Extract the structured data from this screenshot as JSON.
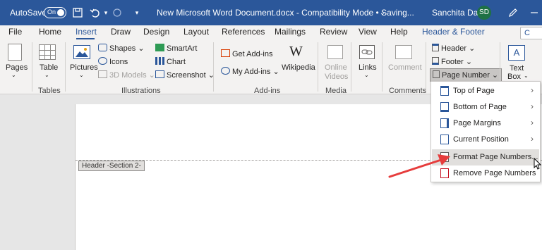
{
  "titlebar": {
    "autosave_label": "AutoSave",
    "autosave_state": "On",
    "doc_title": "New Microsoft Word Document.docx  -  Compatibility Mode • Saving...",
    "user_name": "Sanchita Das",
    "user_initials": "SD"
  },
  "tabs": {
    "file": "File",
    "home": "Home",
    "insert": "Insert",
    "draw": "Draw",
    "design": "Design",
    "layout": "Layout",
    "references": "References",
    "mailings": "Mailings",
    "review": "Review",
    "view": "View",
    "help": "Help",
    "header_footer": "Header & Footer",
    "comments": "C"
  },
  "ribbon": {
    "pages": "Pages",
    "table": "Table",
    "pictures": "Pictures",
    "shapes": "Shapes",
    "icons": "Icons",
    "models_3d": "3D Models",
    "smartart": "SmartArt",
    "chart": "Chart",
    "screenshot": "Screenshot",
    "get_addins": "Get Add-ins",
    "my_addins": "My Add-ins",
    "wikipedia": "Wikipedia",
    "online": "Online",
    "videos": "Videos",
    "links": "Links",
    "comment": "Comment",
    "header": "Header",
    "footer": "Footer",
    "page_number": "Page Number",
    "text": "Text",
    "box": "Box",
    "groups": {
      "tables": "Tables",
      "illustrations": "Illustrations",
      "addins": "Add-ins",
      "media": "Media",
      "comments": "Comments"
    }
  },
  "document": {
    "section_tag": "Header -Section 2-"
  },
  "menu": {
    "items": [
      {
        "label": "Top of Page",
        "submenu": true
      },
      {
        "label": "Bottom of Page",
        "submenu": true
      },
      {
        "label": "Page Margins",
        "submenu": true
      },
      {
        "label": "Current Position",
        "submenu": true
      },
      {
        "label": "Format Page Numbers...",
        "submenu": false
      },
      {
        "label": "Remove Page Numbers",
        "submenu": false
      }
    ]
  },
  "colors": {
    "titlebar": "#2b579a",
    "annotation_arrow": "#e63c3c"
  }
}
